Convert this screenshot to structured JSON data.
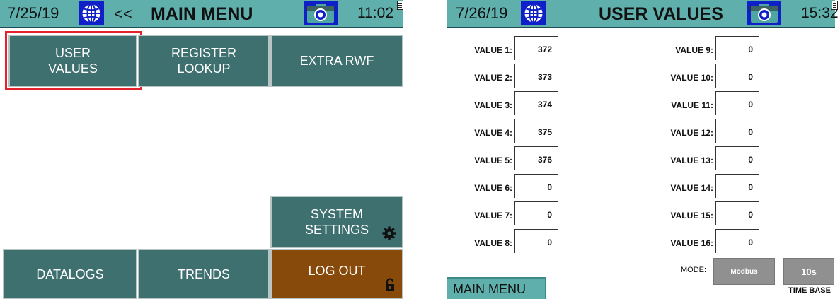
{
  "left_screen": {
    "header": {
      "date": "7/25/19",
      "back": "<<",
      "title": "MAIN MENU",
      "time": "11:02"
    },
    "buttons": {
      "user_values": [
        "USER",
        "VALUES"
      ],
      "register_lookup": [
        "REGISTER",
        "LOOKUP"
      ],
      "extra_rwf": "EXTRA RWF",
      "system_settings": [
        "SYSTEM",
        "SETTINGS"
      ],
      "datalogs": "DATALOGS",
      "trends": "TRENDS",
      "log_out": "LOG OUT"
    },
    "icons": [
      "globe-icon",
      "camera-icon",
      "clipboard-icon",
      "gear-icon",
      "unlock-icon"
    ],
    "colors": {
      "header": "#5fb0ac",
      "button": "#3f7070",
      "logout": "#874a0a",
      "highlight": "#e4222b",
      "icon_bg": "#1020c8"
    }
  },
  "right_screen": {
    "header": {
      "date": "7/26/19",
      "title": "USER VALUES",
      "time": "15:32"
    },
    "values_left": [
      {
        "label": "VALUE 1:",
        "value": "372"
      },
      {
        "label": "VALUE 2:",
        "value": "373"
      },
      {
        "label": "VALUE 3:",
        "value": "374"
      },
      {
        "label": "VALUE 4:",
        "value": "375"
      },
      {
        "label": "VALUE 5:",
        "value": "376"
      },
      {
        "label": "VALUE 6:",
        "value": "0"
      },
      {
        "label": "VALUE 7:",
        "value": "0"
      },
      {
        "label": "VALUE 8:",
        "value": "0"
      }
    ],
    "values_right": [
      {
        "label": "VALUE 9:",
        "value": "0"
      },
      {
        "label": "VALUE 10:",
        "value": "0"
      },
      {
        "label": "VALUE 11:",
        "value": "0"
      },
      {
        "label": "VALUE 12:",
        "value": "0"
      },
      {
        "label": "VALUE 13:",
        "value": "0"
      },
      {
        "label": "VALUE 14:",
        "value": "0"
      },
      {
        "label": "VALUE 15:",
        "value": "0"
      },
      {
        "label": "VALUE 16:",
        "value": "0"
      }
    ],
    "mode_label": "MODE:",
    "mode_value": "Modbus",
    "time_base_value": "10s",
    "time_base_label": "TIME BASE",
    "main_menu": "MAIN MENU",
    "icons": [
      "globe-icon",
      "camera-icon",
      "clipboard-icon"
    ]
  }
}
